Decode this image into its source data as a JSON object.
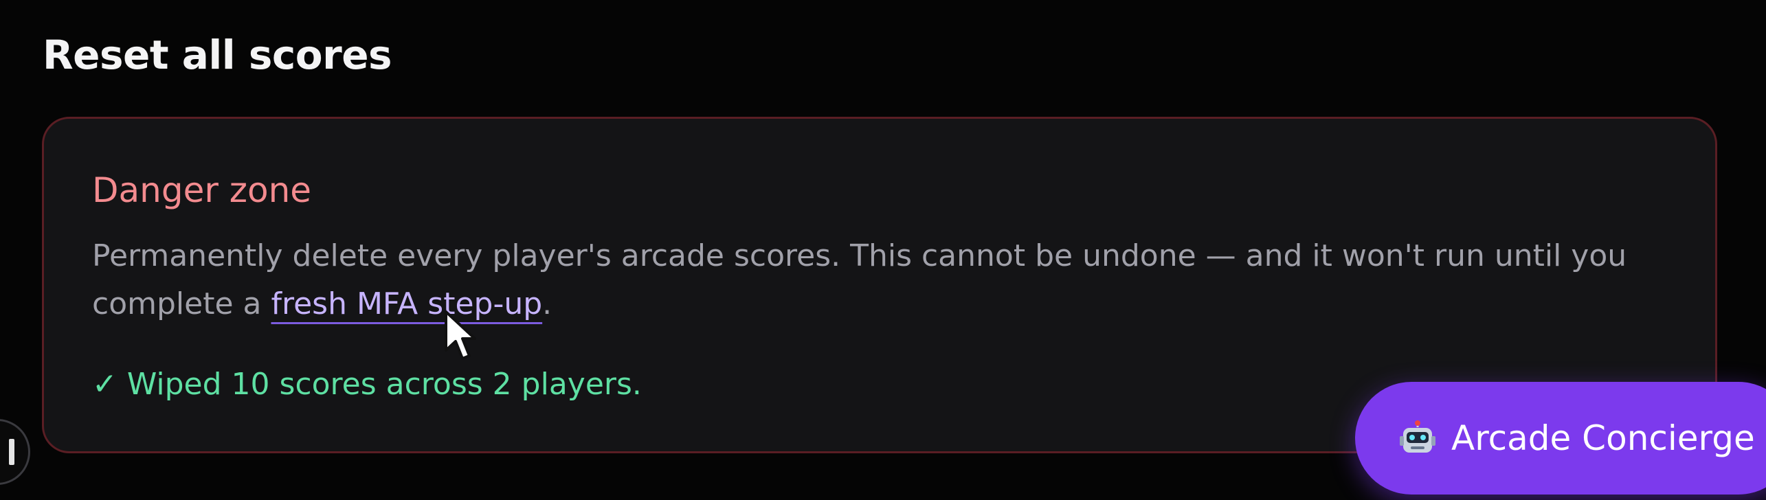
{
  "page": {
    "title": "Reset all scores"
  },
  "danger_zone": {
    "heading": "Danger zone",
    "description_prefix": "Permanently delete every player's arcade scores. This cannot be undone — and it won't run until you complete a ",
    "mfa_link_label": "fresh MFA step-up",
    "description_suffix": ".",
    "status_message": "✓ Wiped 10 scores across 2 players."
  },
  "concierge": {
    "label": "Arcade Concierge",
    "icon": "robot-icon"
  },
  "edge_widget": {
    "icon": "feedback-icon"
  },
  "colors": {
    "background": "#050505",
    "card_background": "#141416",
    "card_border": "#5a1e24",
    "danger_heading": "#f38b8f",
    "link": "#c7b4ff",
    "success": "#5ee0a3",
    "accent": "#7c3aed"
  }
}
